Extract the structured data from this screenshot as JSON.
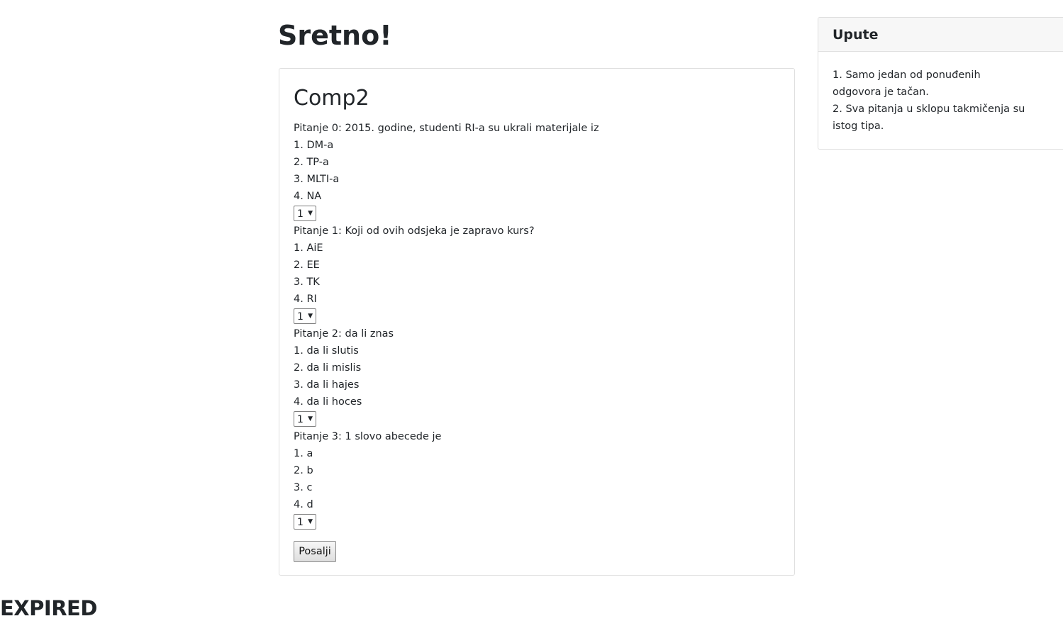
{
  "page": {
    "title": "Sretno!",
    "footer_status": "EXPIRED"
  },
  "quiz": {
    "title": "Comp2",
    "questions": [
      {
        "text": "Pitanje 0: 2015. godine, studenti RI-a su ukrali materijale iz",
        "options": [
          "1. DM-a",
          "2. TP-a",
          "3. MLTI-a",
          "4. NA"
        ],
        "selected": "1"
      },
      {
        "text": "Pitanje 1: Koji od ovih odsjeka je zapravo kurs?",
        "options": [
          "1. AiE",
          "2. EE",
          "3. TK",
          "4. RI"
        ],
        "selected": "1"
      },
      {
        "text": "Pitanje 2: da li znas",
        "options": [
          "1. da li slutis",
          "2. da li mislis",
          "3. da li hajes",
          "4. da li hoces"
        ],
        "selected": "1"
      },
      {
        "text": "Pitanje 3: 1 slovo abecede je",
        "options": [
          "1. a",
          "2. b",
          "3. c",
          "4. d"
        ],
        "selected": "1"
      }
    ],
    "submit_label": "Posalji"
  },
  "instructions": {
    "title": "Upute",
    "items": [
      "1. Samo jedan od ponuđenih odgovora je tačan.",
      "2. Sva pitanja u sklopu takmičenja su istog tipa."
    ]
  },
  "icons": {
    "select_arrow": "dropdown-arrow-icon"
  }
}
